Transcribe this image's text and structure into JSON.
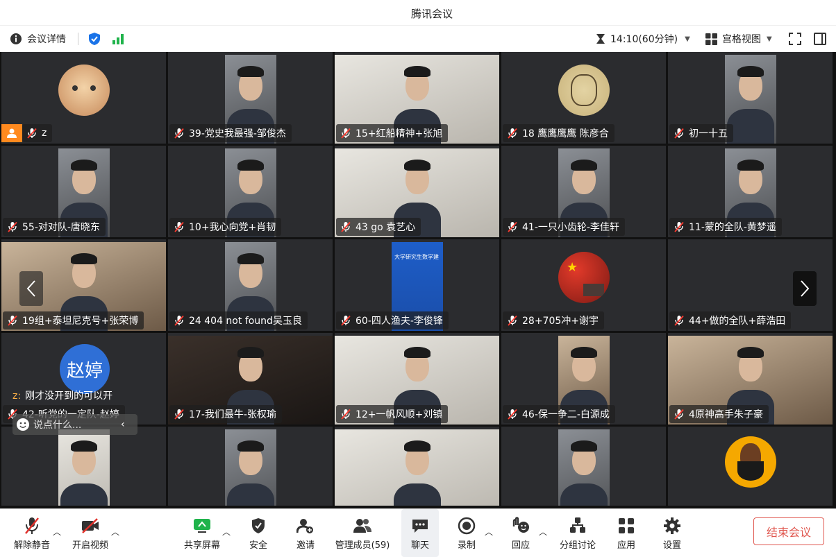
{
  "window": {
    "title": "腾讯会议"
  },
  "infobar": {
    "details_label": "会议详情",
    "timer": "14:10(60分钟)",
    "view_label": "宫格视图"
  },
  "tiles": [
    {
      "name": "z",
      "kind": "avatar-cat"
    },
    {
      "name": "39-党史我最强-邹俊杰",
      "kind": "video"
    },
    {
      "name": "15+红船精神+张旭",
      "kind": "video-light"
    },
    {
      "name": "18  鹰鹰鹰鹰  陈彦合",
      "kind": "avatar-art"
    },
    {
      "name": "初一十五",
      "kind": "video"
    },
    {
      "name": "55-对对队-唐晓东",
      "kind": "video"
    },
    {
      "name": "10+我心向党+肖韧",
      "kind": "video"
    },
    {
      "name": "43 go 袁艺心",
      "kind": "video-light"
    },
    {
      "name": "41-一只小齿轮-李佳轩",
      "kind": "video"
    },
    {
      "name": "11-蒙的全队-黄梦遥",
      "kind": "video"
    },
    {
      "name": "19组+泰坦尼克号+张荣博",
      "kind": "video-warm"
    },
    {
      "name": "24 404 not found吴玉良",
      "kind": "video"
    },
    {
      "name": "60-四人渔夫-李俊锋",
      "kind": "video-blue"
    },
    {
      "name": "28+705冲+谢宇",
      "kind": "avatar-flag"
    },
    {
      "name": "44+做的全队+薛浩田",
      "kind": "empty"
    },
    {
      "name": "42-听党的一定队-赵婷",
      "kind": "avatar-text"
    },
    {
      "name": "17-我们最牛-张权瑜",
      "kind": "video-dark"
    },
    {
      "name": "12+一帆风顺+刘镇",
      "kind": "video-light"
    },
    {
      "name": "46-保一争二-白源成",
      "kind": "video-warm"
    },
    {
      "name": "4原神高手朱子豪",
      "kind": "video-warm"
    },
    {
      "name": "",
      "kind": "video-light"
    },
    {
      "name": "",
      "kind": "video"
    },
    {
      "name": "",
      "kind": "video-light"
    },
    {
      "name": "",
      "kind": "video"
    },
    {
      "name": "",
      "kind": "avatar-beard"
    }
  ],
  "avatar_text": "赵婷",
  "chat": {
    "sender": "z:",
    "message": "刚才没开到的可以开",
    "input_placeholder": "说点什么..."
  },
  "toolbar": {
    "unmute": "解除静音",
    "start_video": "开启视频",
    "share_screen": "共享屏幕",
    "security": "安全",
    "invite": "邀请",
    "manage_members": "管理成员(59)",
    "chat": "聊天",
    "record": "录制",
    "reactions": "回应",
    "breakout": "分组讨论",
    "apps": "应用",
    "settings": "设置",
    "end_meeting": "结束会议"
  },
  "colors": {
    "accent": "#1a73e8",
    "end": "#e0574f",
    "host_badge": "#ff8a1f",
    "signal": "#1fb34b"
  }
}
